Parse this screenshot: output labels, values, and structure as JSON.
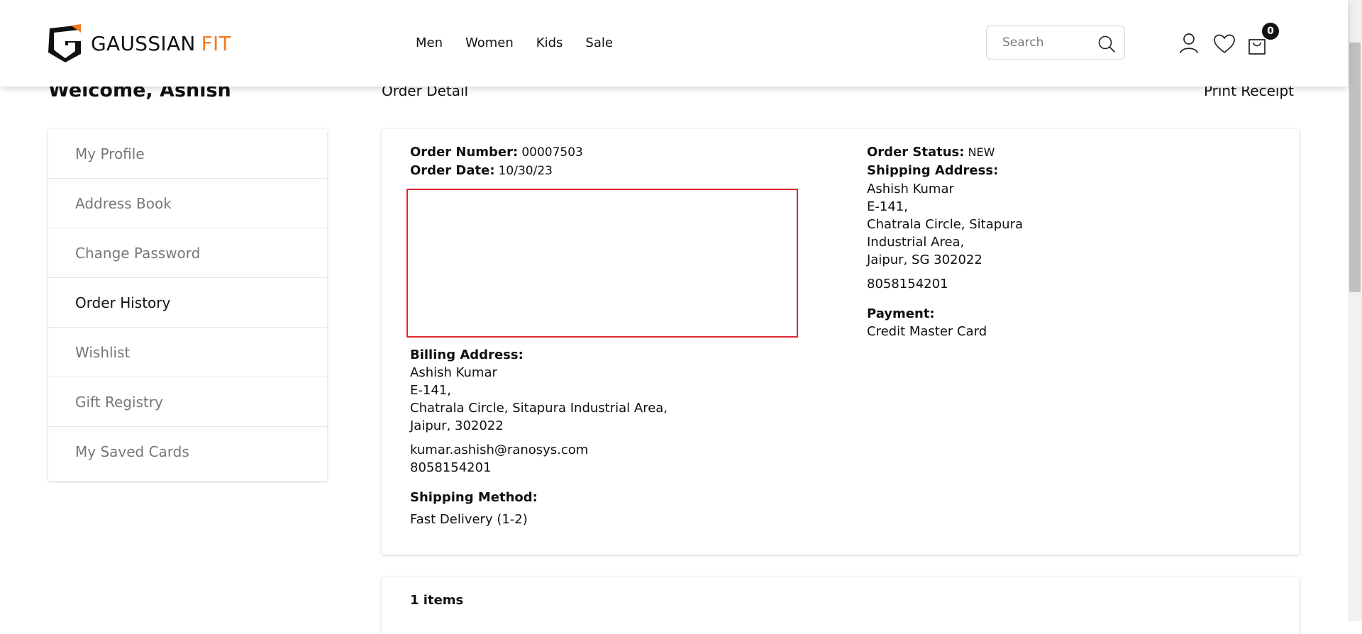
{
  "header": {
    "logo_text_1": "GAUSSIAN",
    "logo_text_2": "FIT",
    "nav": [
      "Men",
      "Women",
      "Kids",
      "Sale"
    ],
    "search_placeholder": "Search",
    "cart_count": "0",
    "accent_color": "#f47a20"
  },
  "page": {
    "welcome": "Welcome, Ashish",
    "order_detail_title": "Order Detail",
    "print_receipt": "Print Receipt"
  },
  "sidebar": {
    "items": [
      {
        "label": "My Profile"
      },
      {
        "label": "Address Book"
      },
      {
        "label": "Change Password"
      },
      {
        "label": "Order History"
      },
      {
        "label": "Wishlist"
      },
      {
        "label": "Gift Registry"
      },
      {
        "label": "My Saved Cards"
      }
    ],
    "active_index": 3
  },
  "order": {
    "number_label": "Order Number:",
    "number": "00007503",
    "date_label": "Order Date:",
    "date": "10/30/23",
    "status_label": "Order Status:",
    "status": "NEW",
    "shipping_address_label": "Shipping Address:",
    "shipping_address": [
      "Ashish Kumar",
      "E-141,",
      "Chatrala Circle, Sitapura",
      "Industrial Area,",
      "Jaipur, SG 302022"
    ],
    "shipping_phone": "8058154201",
    "payment_label": "Payment:",
    "payment": "Credit Master Card",
    "billing_address_label": "Billing Address:",
    "billing_address": [
      "Ashish Kumar",
      "E-141,",
      "Chatrala Circle, Sitapura Industrial Area,",
      "Jaipur, 302022"
    ],
    "billing_email": "kumar.ashish@ranosys.com",
    "billing_phone": "8058154201",
    "shipping_method_label": "Shipping Method:",
    "shipping_method": "Fast Delivery (1-2)"
  },
  "items": {
    "count_label": "1 items"
  }
}
